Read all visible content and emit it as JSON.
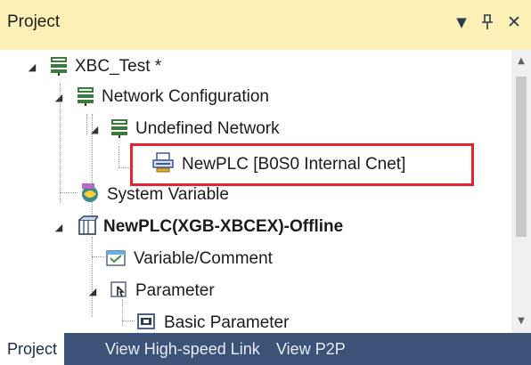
{
  "panel": {
    "title": "Project",
    "buttons": {
      "dropdown": "▼",
      "pin": "ᵖ",
      "close": "✕"
    }
  },
  "tree": {
    "items": [
      {
        "label": "XBC_Test *",
        "icon": "project-icon",
        "expanded": true,
        "bold": false
      },
      {
        "label": "Network Configuration",
        "icon": "network-config-icon",
        "expanded": true,
        "bold": false
      },
      {
        "label": "Undefined Network",
        "icon": "network-icon",
        "expanded": true,
        "bold": false
      },
      {
        "label": "NewPLC [B0S0 Internal Cnet]",
        "icon": "plc-station-icon",
        "expanded": false,
        "bold": false,
        "highlighted": true
      },
      {
        "label": "System Variable",
        "icon": "system-variable-icon",
        "expanded": false,
        "bold": false
      },
      {
        "label": "NewPLC(XGB-XBCEX)-Offline",
        "icon": "plc-icon",
        "expanded": true,
        "bold": true
      },
      {
        "label": "Variable/Comment",
        "icon": "variable-comment-icon",
        "expanded": false,
        "bold": false
      },
      {
        "label": "Parameter",
        "icon": "parameter-icon",
        "expanded": true,
        "bold": false
      },
      {
        "label": "Basic Parameter",
        "icon": "basic-parameter-icon",
        "expanded": false,
        "bold": false
      }
    ]
  },
  "tabs": [
    {
      "label": "Project",
      "active": true
    },
    {
      "label": "View High-speed Link",
      "active": false
    },
    {
      "label": "View P2P",
      "active": false
    }
  ],
  "colors": {
    "title_bg": "#fdf0b6",
    "tab_bar_bg": "#3d5277",
    "highlight": "#e8232d"
  }
}
